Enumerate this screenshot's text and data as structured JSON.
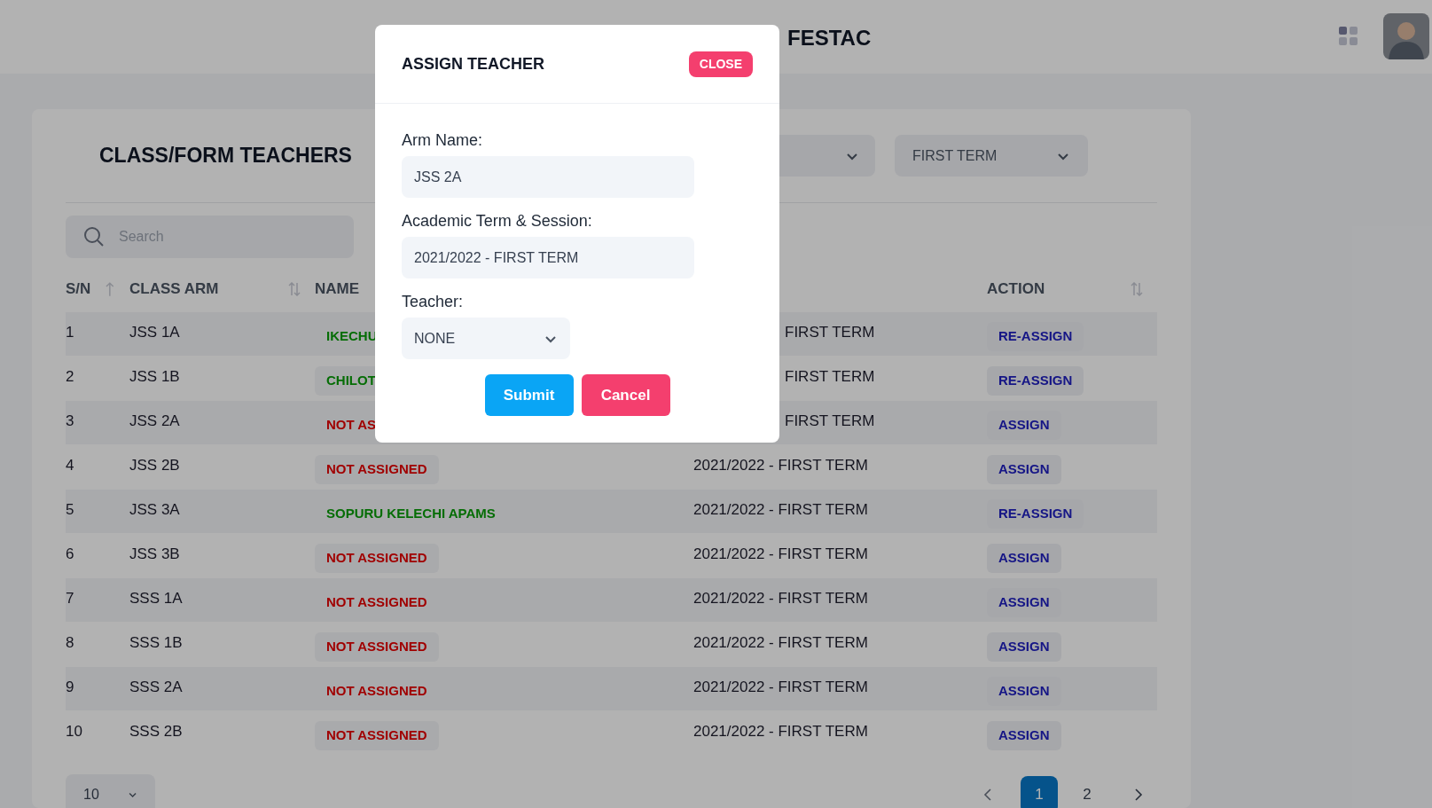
{
  "header": {
    "title": "FESTAC"
  },
  "page": {
    "title": "CLASS/FORM TEACHERS",
    "filters": [
      {
        "value": "FIRST TERM"
      }
    ]
  },
  "search": {
    "placeholder": "Search"
  },
  "table": {
    "columns": [
      {
        "label": "S/N",
        "kind": "sort-up"
      },
      {
        "label": "CLASS ARM",
        "kind": "sort"
      },
      {
        "label": "NAME",
        "kind": "plain"
      },
      {
        "label": "ACTION",
        "kind": "sort"
      }
    ],
    "rows": [
      {
        "sn": "1",
        "class_arm": "JSS 1A",
        "name": "IKECHU",
        "assigned": true,
        "session": "FIRST TERM",
        "session_cut": true,
        "action": "RE-ASSIGN"
      },
      {
        "sn": "2",
        "class_arm": "JSS 1B",
        "name": "CHILOT",
        "assigned": true,
        "session": "FIRST TERM",
        "session_cut": true,
        "action": "RE-ASSIGN"
      },
      {
        "sn": "3",
        "class_arm": "JSS 2A",
        "name": "NOT AS",
        "assigned": false,
        "session": "FIRST TERM",
        "session_cut": true,
        "action": "ASSIGN"
      },
      {
        "sn": "4",
        "class_arm": "JSS 2B",
        "name": "NOT ASSIGNED",
        "assigned": false,
        "session": "2021/2022 - FIRST TERM",
        "session_cut": false,
        "action": "ASSIGN"
      },
      {
        "sn": "5",
        "class_arm": "JSS 3A",
        "name": "SOPURU KELECHI APAMS",
        "assigned": true,
        "session": "2021/2022 - FIRST TERM",
        "session_cut": false,
        "action": "RE-ASSIGN"
      },
      {
        "sn": "6",
        "class_arm": "JSS 3B",
        "name": "NOT ASSIGNED",
        "assigned": false,
        "session": "2021/2022 - FIRST TERM",
        "session_cut": false,
        "action": "ASSIGN"
      },
      {
        "sn": "7",
        "class_arm": "SSS 1A",
        "name": "NOT ASSIGNED",
        "assigned": false,
        "session": "2021/2022 - FIRST TERM",
        "session_cut": false,
        "action": "ASSIGN"
      },
      {
        "sn": "8",
        "class_arm": "SSS 1B",
        "name": "NOT ASSIGNED",
        "assigned": false,
        "session": "2021/2022 - FIRST TERM",
        "session_cut": false,
        "action": "ASSIGN"
      },
      {
        "sn": "9",
        "class_arm": "SSS 2A",
        "name": "NOT ASSIGNED",
        "assigned": false,
        "session": "2021/2022 - FIRST TERM",
        "session_cut": false,
        "action": "ASSIGN"
      },
      {
        "sn": "10",
        "class_arm": "SSS 2B",
        "name": "NOT ASSIGNED",
        "assigned": false,
        "session": "2021/2022 - FIRST TERM",
        "session_cut": false,
        "action": "ASSIGN"
      }
    ]
  },
  "pagination": {
    "page_size": "10",
    "pages": [
      {
        "label": "1",
        "selected": true
      },
      {
        "label": "2",
        "selected": false
      }
    ]
  },
  "modal": {
    "title": "ASSIGN TEACHER",
    "close": "CLOSE",
    "fields": [
      {
        "label": "Arm Name:",
        "value": "JSS 2A",
        "kind": "input"
      },
      {
        "label": "Academic Term & Session:",
        "value": "2021/2022 - FIRST TERM",
        "kind": "input"
      },
      {
        "label": "Teacher:",
        "value": "NONE",
        "kind": "select"
      }
    ],
    "buttons": [
      {
        "label": "Submit",
        "kind": "primary"
      },
      {
        "label": "Cancel",
        "kind": "danger"
      }
    ]
  }
}
